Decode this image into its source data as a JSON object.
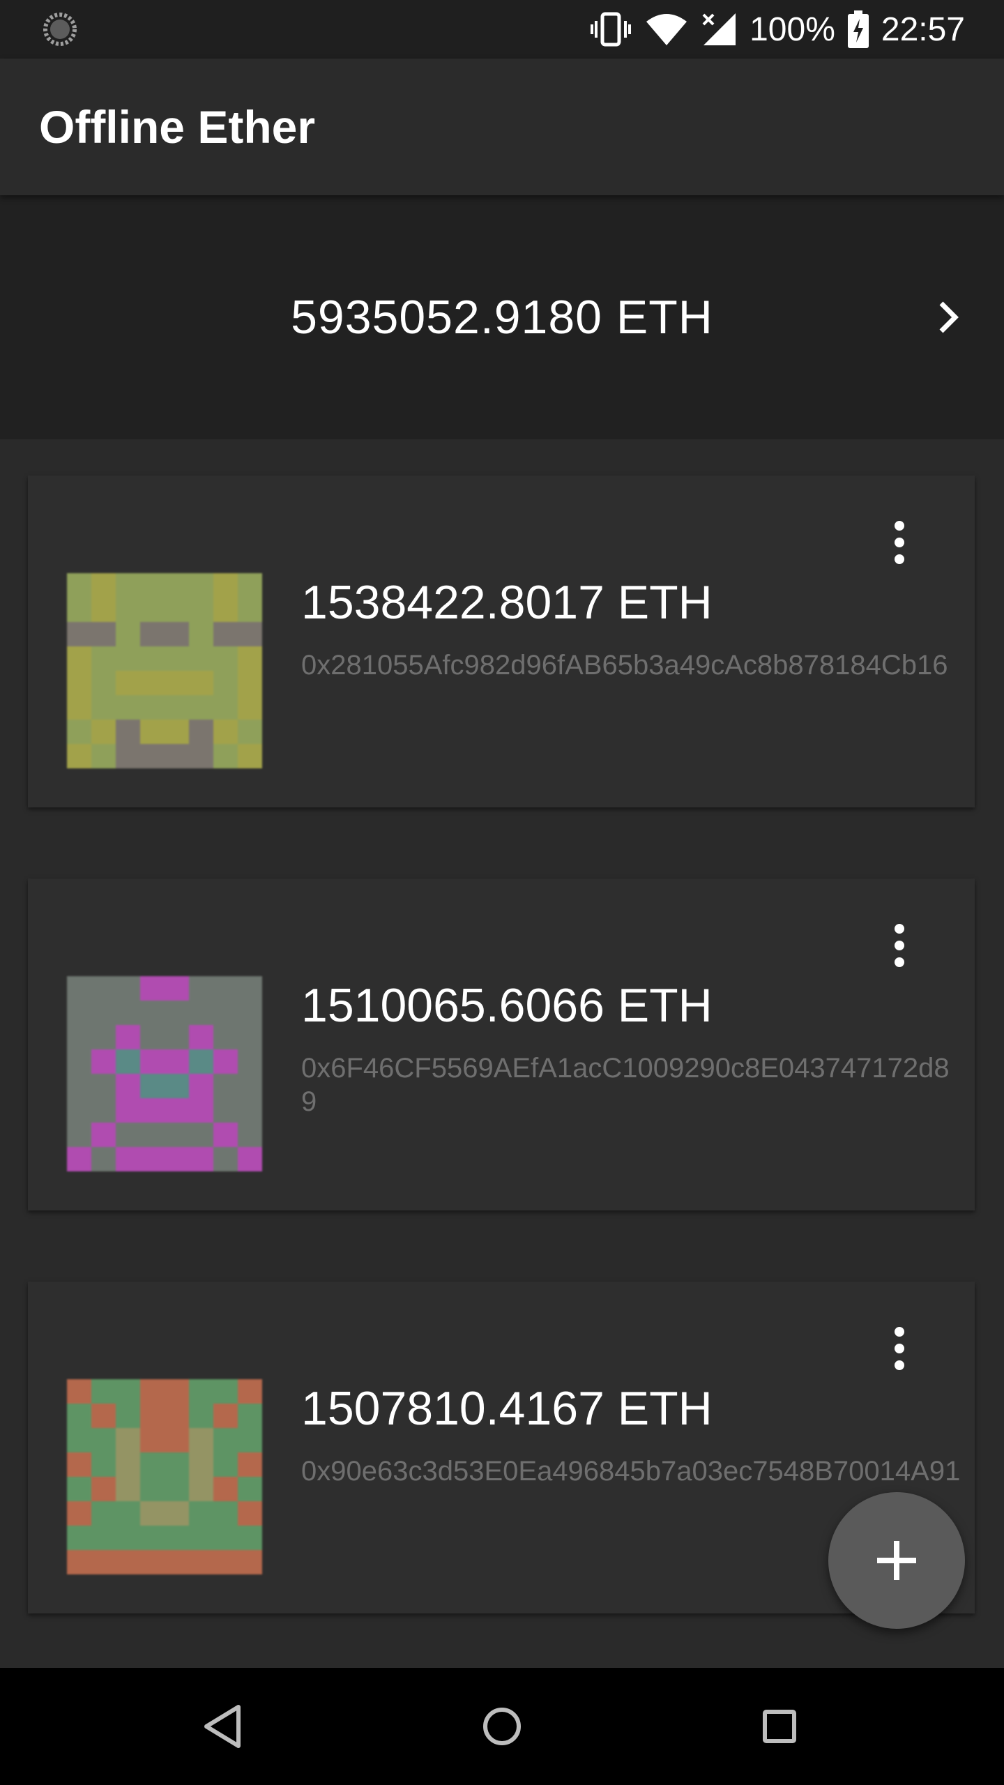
{
  "status_bar": {
    "battery": "100%",
    "time": "22:57",
    "icons": [
      "sync-icon",
      "vibrate-icon",
      "wifi-icon",
      "no-signal-icon",
      "battery-charging-icon"
    ]
  },
  "app_bar": {
    "title": "Offline Ether"
  },
  "total": {
    "value": "5935052.9180 ETH",
    "icon": "chevron-right-icon"
  },
  "wallets": [
    {
      "amount": "1538422.8017 ETH",
      "address": "0x281055Afc982d96fAB65b3a49cAc8b878184Cb16",
      "identicon_colors": [
        "#8fa05a",
        "#a2a24a",
        "#7b756e"
      ]
    },
    {
      "amount": "1510065.6066 ETH",
      "address": "0x6F46CF5569AEfA1acC1009290c8E043747172d89",
      "identicon_colors": [
        "#6e7670",
        "#b04cb0",
        "#5a8a86"
      ]
    },
    {
      "amount": "1507810.4167 ETH",
      "address": "0x90e63c3d53E0Ea496845b7a03ec7548B70014A91",
      "identicon_colors": [
        "#5e9464",
        "#b4684c",
        "#949464"
      ]
    }
  ],
  "fab": {
    "icon": "plus-icon"
  },
  "nav": [
    "back-icon",
    "home-icon",
    "recents-icon"
  ]
}
